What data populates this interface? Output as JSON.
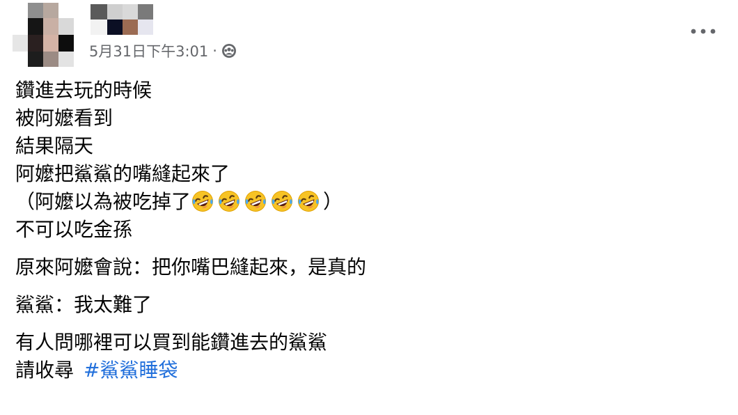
{
  "post": {
    "timestamp": "5月31日下午3:01",
    "separator": "·",
    "audience_icon": "public-globe-icon",
    "more_icon": "more-options-icon",
    "lines": [
      "鑽進去玩的時候",
      "被阿嬤看到",
      "結果隔天",
      "阿嬤把鯊鯊的嘴縫起來了"
    ],
    "paren_open": "（阿嬤以為被吃掉了",
    "emoji_name": "rolling-on-floor-laughing-emoji",
    "emoji_count": 5,
    "paren_close": "）",
    "line_after_paren": "不可以吃金孫",
    "paragraph_2": "原來阿嬤會說：把你嘴巴縫起來，是真的",
    "paragraph_3": "鯊鯊：我太難了",
    "paragraph_4_line_1": "有人問哪裡可以買到能鑽進去的鯊鯊",
    "paragraph_4_line_2_prefix": "請收尋",
    "hashtag": "#鯊鯊睡袋"
  },
  "colors": {
    "meta_text": "#65676b",
    "hashtag": "#216fdb",
    "body_text": "#050505"
  }
}
